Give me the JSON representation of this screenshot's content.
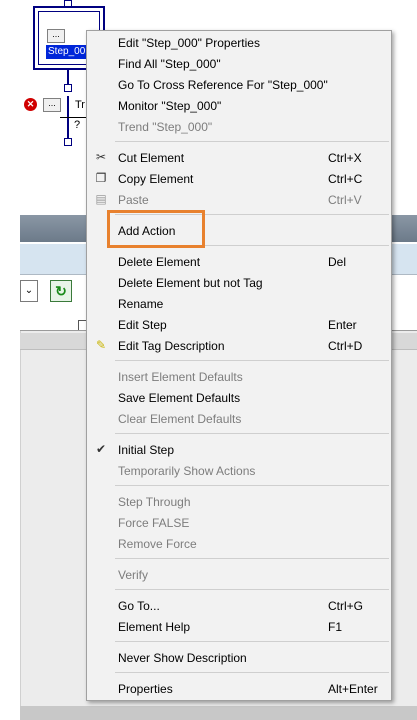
{
  "ladder": {
    "step_label": "Step_00",
    "ellipsis": "...",
    "tr_label": "Tr",
    "question": "?",
    "error_glyph": "✕"
  },
  "toolbar": {
    "combo_arrow": "⌄",
    "refresh_glyph": "↻"
  },
  "menu": {
    "items": [
      {
        "label": "Edit \"Step_000\" Properties",
        "shortcut": "",
        "enabled": true,
        "icon": ""
      },
      {
        "label": "Find All \"Step_000\"",
        "shortcut": "",
        "enabled": true,
        "icon": ""
      },
      {
        "label": "Go To Cross Reference For \"Step_000\"",
        "shortcut": "",
        "enabled": true,
        "icon": ""
      },
      {
        "label": "Monitor \"Step_000\"",
        "shortcut": "",
        "enabled": true,
        "icon": ""
      },
      {
        "label": "Trend \"Step_000\"",
        "shortcut": "",
        "enabled": false,
        "icon": ""
      },
      {
        "label": "Cut Element",
        "shortcut": "Ctrl+X",
        "enabled": true,
        "icon": "scissors-icon"
      },
      {
        "label": "Copy Element",
        "shortcut": "Ctrl+C",
        "enabled": true,
        "icon": "copy-icon"
      },
      {
        "label": "Paste",
        "shortcut": "Ctrl+V",
        "enabled": false,
        "icon": "paste-icon"
      },
      {
        "label": "Add Action",
        "shortcut": "",
        "enabled": true,
        "icon": ""
      },
      {
        "label": "Delete Element",
        "shortcut": "Del",
        "enabled": true,
        "icon": ""
      },
      {
        "label": "Delete Element but not Tag",
        "shortcut": "",
        "enabled": true,
        "icon": ""
      },
      {
        "label": "Rename",
        "shortcut": "",
        "enabled": true,
        "icon": ""
      },
      {
        "label": "Edit Step",
        "shortcut": "Enter",
        "enabled": true,
        "icon": ""
      },
      {
        "label": "Edit Tag Description",
        "shortcut": "Ctrl+D",
        "enabled": true,
        "icon": "pencil-icon"
      },
      {
        "label": "Insert Element Defaults",
        "shortcut": "",
        "enabled": false,
        "icon": ""
      },
      {
        "label": "Save Element Defaults",
        "shortcut": "",
        "enabled": true,
        "icon": ""
      },
      {
        "label": "Clear Element Defaults",
        "shortcut": "",
        "enabled": false,
        "icon": ""
      },
      {
        "label": "Initial Step",
        "shortcut": "",
        "enabled": true,
        "icon": "check-icon"
      },
      {
        "label": "Temporarily Show Actions",
        "shortcut": "",
        "enabled": false,
        "icon": ""
      },
      {
        "label": "Step Through",
        "shortcut": "",
        "enabled": false,
        "icon": ""
      },
      {
        "label": "Force FALSE",
        "shortcut": "",
        "enabled": false,
        "icon": ""
      },
      {
        "label": "Remove Force",
        "shortcut": "",
        "enabled": false,
        "icon": ""
      },
      {
        "label": "Verify",
        "shortcut": "",
        "enabled": false,
        "icon": ""
      },
      {
        "label": "Go To...",
        "shortcut": "Ctrl+G",
        "enabled": true,
        "icon": ""
      },
      {
        "label": "Element Help",
        "shortcut": "F1",
        "enabled": true,
        "icon": ""
      },
      {
        "label": "Never Show Description",
        "shortcut": "",
        "enabled": true,
        "icon": ""
      },
      {
        "label": "Properties",
        "shortcut": "Alt+Enter",
        "enabled": true,
        "icon": ""
      }
    ],
    "icon_glyphs": {
      "scissors": "✂",
      "copy": "❐",
      "paste": "▤",
      "pencil": "✎",
      "check": "✔"
    }
  },
  "highlight_color": "#e8812e"
}
